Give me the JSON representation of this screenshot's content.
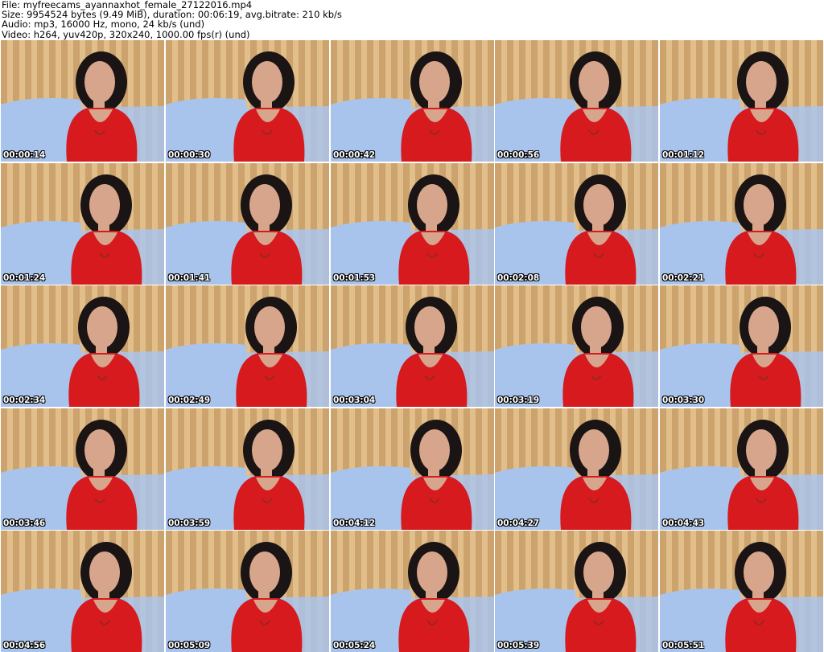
{
  "header": {
    "file_line": "File: myfreecams_ayannaxhot_female_27122016.mp4",
    "size_line": "Size: 9954524 bytes (9.49 MiB), duration: 00:06:19, avg.bitrate: 210 kb/s",
    "audio_line": "Audio: mp3, 16000 Hz, mono, 24 kb/s (und)",
    "video_line": "Video: h264, yuv420p, 320x240, 1000.00 fps(r) (und)"
  },
  "thumbnails": [
    {
      "timestamp": "00:00:14"
    },
    {
      "timestamp": "00:00:30"
    },
    {
      "timestamp": "00:00:42"
    },
    {
      "timestamp": "00:00:56"
    },
    {
      "timestamp": "00:01:12"
    },
    {
      "timestamp": "00:01:24"
    },
    {
      "timestamp": "00:01:41"
    },
    {
      "timestamp": "00:01:53"
    },
    {
      "timestamp": "00:02:08"
    },
    {
      "timestamp": "00:02:21"
    },
    {
      "timestamp": "00:02:34"
    },
    {
      "timestamp": "00:02:49"
    },
    {
      "timestamp": "00:03:04"
    },
    {
      "timestamp": "00:03:19"
    },
    {
      "timestamp": "00:03:30"
    },
    {
      "timestamp": "00:03:46"
    },
    {
      "timestamp": "00:03:59"
    },
    {
      "timestamp": "00:04:12"
    },
    {
      "timestamp": "00:04:27"
    },
    {
      "timestamp": "00:04:43"
    },
    {
      "timestamp": "00:04:56"
    },
    {
      "timestamp": "00:05:09"
    },
    {
      "timestamp": "00:05:24"
    },
    {
      "timestamp": "00:05:39"
    },
    {
      "timestamp": "00:05:51"
    }
  ],
  "colors": {
    "curtain_light": "#e2bf8a",
    "curtain_dark": "#b98a55",
    "sofa": "#a9c4ec",
    "top": "#d61a1e",
    "hair": "#1a1414",
    "skin": "#d7a58b"
  }
}
